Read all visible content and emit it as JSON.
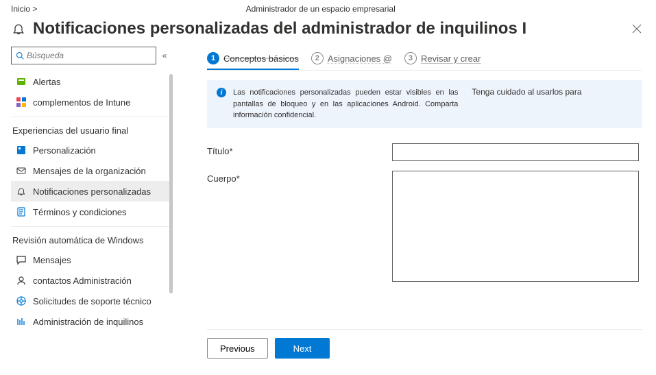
{
  "breadcrumb": "Inicio >",
  "tenant_label": "Administrador de un espacio empresarial",
  "page_title": "Notificaciones personalizadas del administrador de inquilinos I",
  "search": {
    "placeholder": "Búsqueda"
  },
  "sidebar": {
    "top_items": [
      {
        "label": "Alertas",
        "icon": "alerts"
      },
      {
        "label": "complementos de Intune",
        "icon": "addons"
      }
    ],
    "section1": {
      "header": "Experiencias del usuario final",
      "items": [
        {
          "label": "Personalización",
          "icon": "custom"
        },
        {
          "label": "Mensajes de la organización",
          "icon": "org-msg"
        },
        {
          "label": "Notificaciones personalizadas",
          "icon": "bell",
          "selected": true
        },
        {
          "label": "Términos y condiciones",
          "icon": "terms"
        }
      ]
    },
    "section2": {
      "header": "Revisión automática de Windows",
      "items": [
        {
          "label": "Mensajes",
          "icon": "messages"
        },
        {
          "label": "contactos Administración",
          "icon": "contact"
        },
        {
          "label": "Solicitudes de soporte técnico",
          "icon": "support"
        },
        {
          "label": "Administración de inquilinos",
          "icon": "tenant"
        }
      ]
    }
  },
  "stepper": {
    "step1": {
      "num": "1",
      "label": "Conceptos básicos"
    },
    "step2": {
      "num": "2",
      "label": "Asignaciones @"
    },
    "step3": {
      "num": "3",
      "label": "Revisar y crear"
    }
  },
  "info_banner": {
    "left": "Las notificaciones personalizadas pueden estar visibles en las pantallas de bloqueo y en las aplicaciones Android. Comparta información confidencial.",
    "right": "Tenga cuidado al usarlos para"
  },
  "form": {
    "title_label": "Título*",
    "body_label": "Cuerpo*",
    "title_value": "",
    "body_value": ""
  },
  "footer": {
    "prev": "Previous",
    "next": "Next"
  }
}
